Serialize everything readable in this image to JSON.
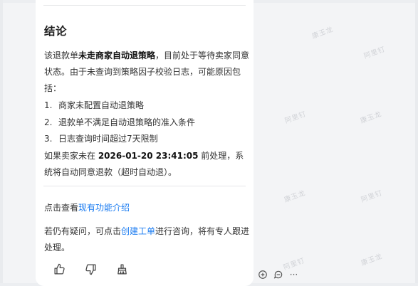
{
  "conclusion": {
    "title": "结论",
    "intro_prefix": "该退款单",
    "intro_bold": "未走商家自动退策略",
    "intro_suffix": "，目前处于等待卖家同意状态。由于未查询到策略因子校验日志，可能原因包括：",
    "reasons": [
      {
        "num": "1.",
        "text": "商家未配置自动退策略"
      },
      {
        "num": "2.",
        "text": "退款单不满足自动退策略的准入条件"
      },
      {
        "num": "3.",
        "text": "日志查询时间超过7天限制"
      }
    ],
    "deadline_prefix": "如果卖家未在 ",
    "deadline_bold": "2026-01-20 23:41:05",
    "deadline_suffix": " 前处理，系统将自动同意退款（超时自动退）。"
  },
  "links": {
    "view_prefix": "点击查看",
    "view_link": "现有功能介绍",
    "ticket_prefix": "若仍有疑问，可点击",
    "ticket_link": "创建工单",
    "ticket_suffix": "进行咨询，将有专人跟进处理。"
  },
  "watermark": {
    "name_a": "康玉龙",
    "name_b": "阿里钉"
  },
  "actions": [
    "thumbs-up-icon",
    "thumbs-down-icon",
    "broom-icon"
  ],
  "side_tools": [
    "add-comment-icon",
    "comment-icon",
    "more-icon"
  ],
  "side_more_label": "···"
}
